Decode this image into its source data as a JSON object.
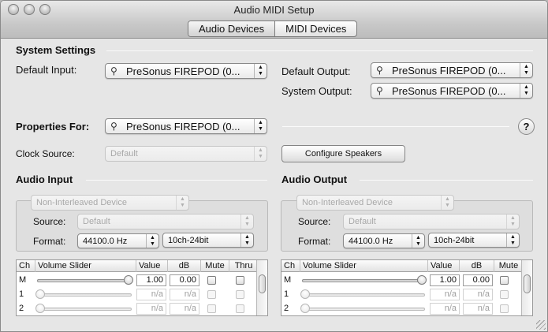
{
  "window": {
    "title": "Audio MIDI Setup"
  },
  "tabs": [
    {
      "label": "Audio Devices",
      "active": true
    },
    {
      "label": "MIDI Devices",
      "active": false
    }
  ],
  "system_settings": {
    "heading": "System Settings",
    "default_input_label": "Default Input:",
    "default_input_value": "PreSonus FIREPOD (0...",
    "default_output_label": "Default Output:",
    "default_output_value": "PreSonus FIREPOD (0...",
    "system_output_label": "System Output:",
    "system_output_value": "PreSonus FIREPOD (0..."
  },
  "properties": {
    "label": "Properties For:",
    "value": "PreSonus FIREPOD (0...",
    "help": "?",
    "clock_source_label": "Clock Source:",
    "clock_source_value": "Default",
    "configure_speakers": "Configure Speakers"
  },
  "audio_input": {
    "heading": "Audio Input",
    "device_mode": "Non-Interleaved Device",
    "source_label": "Source:",
    "source_value": "Default",
    "format_label": "Format:",
    "format_rate": "44100.0 Hz",
    "format_bits": "10ch-24bit",
    "columns": [
      "Ch",
      "Volume Slider",
      "Value",
      "dB",
      "Mute",
      "Thru"
    ],
    "rows": [
      {
        "ch": "M",
        "level": 1.0,
        "value": "1.00",
        "db": "0.00",
        "enabled": true
      },
      {
        "ch": "1",
        "level": 0.0,
        "value": "n/a",
        "db": "n/a",
        "enabled": false
      },
      {
        "ch": "2",
        "level": 0.0,
        "value": "n/a",
        "db": "n/a",
        "enabled": false
      }
    ]
  },
  "audio_output": {
    "heading": "Audio Output",
    "device_mode": "Non-Interleaved Device",
    "source_label": "Source:",
    "source_value": "Default",
    "format_label": "Format:",
    "format_rate": "44100.0 Hz",
    "format_bits": "10ch-24bit",
    "columns": [
      "Ch",
      "Volume Slider",
      "Value",
      "dB",
      "Mute"
    ],
    "rows": [
      {
        "ch": "M",
        "level": 1.0,
        "value": "1.00",
        "db": "0.00",
        "enabled": true
      },
      {
        "ch": "1",
        "level": 0.0,
        "value": "n/a",
        "db": "n/a",
        "enabled": false
      },
      {
        "ch": "2",
        "level": 0.0,
        "value": "n/a",
        "db": "n/a",
        "enabled": false
      }
    ]
  },
  "icons": {
    "device": "firewire-icon",
    "popup": "popup-arrows-icon"
  }
}
